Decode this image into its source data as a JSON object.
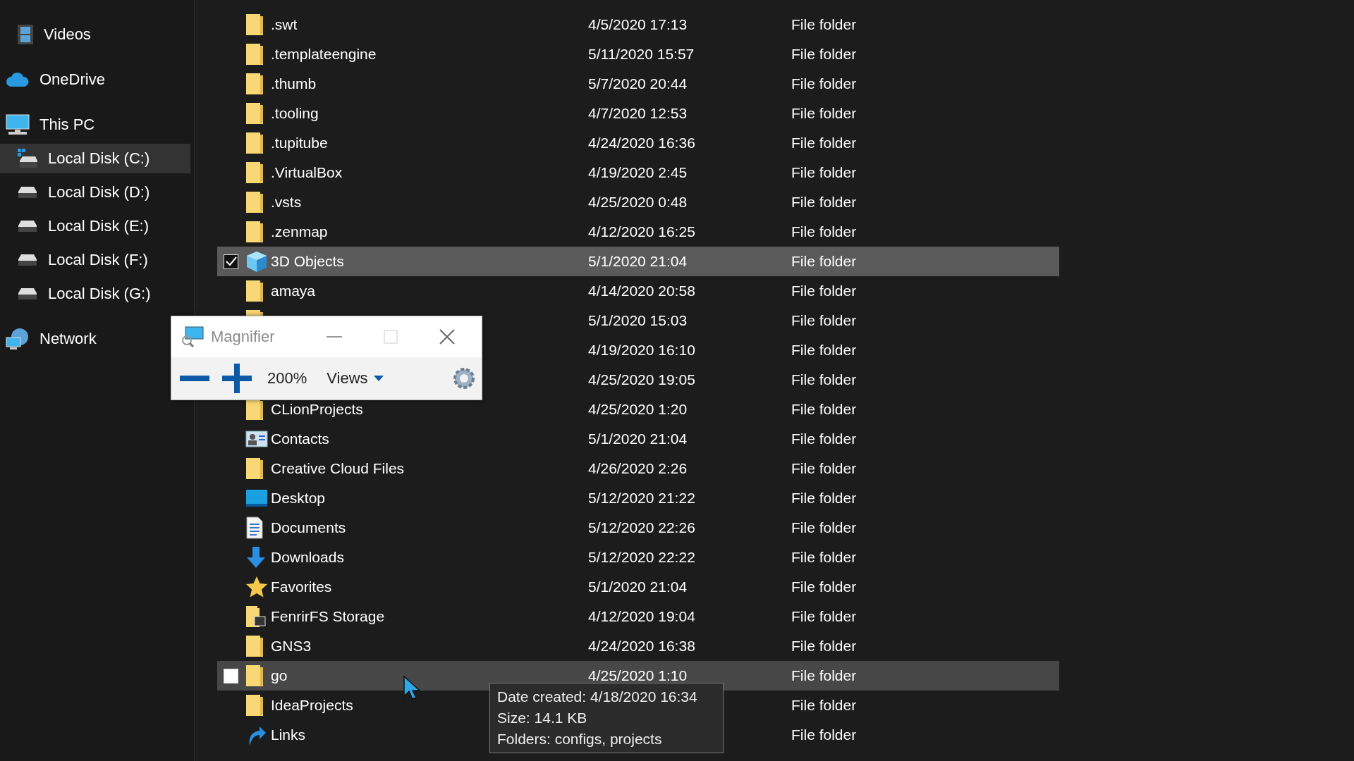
{
  "sidebar": {
    "items": [
      {
        "label": "Videos",
        "kind": "videos",
        "selected": false
      },
      {
        "label": "OneDrive",
        "kind": "cloud",
        "selected": false
      },
      {
        "label": "This PC",
        "kind": "pc",
        "selected": false
      },
      {
        "label": "Local Disk (C:)",
        "kind": "system-disk",
        "selected": true
      },
      {
        "label": "Local Disk (D:)",
        "kind": "disk",
        "selected": false
      },
      {
        "label": "Local Disk (E:)",
        "kind": "disk",
        "selected": false
      },
      {
        "label": "Local Disk (F:)",
        "kind": "disk",
        "selected": false
      },
      {
        "label": "Local Disk (G:)",
        "kind": "disk",
        "selected": false
      },
      {
        "label": "Network",
        "kind": "network",
        "selected": false
      }
    ]
  },
  "files": {
    "rows": [
      {
        "name": ".swt",
        "date": "4/5/2020 17:13",
        "type": "File folder",
        "kind": "folder",
        "selected": false,
        "hover": false
      },
      {
        "name": ".templateengine",
        "date": "5/11/2020 15:57",
        "type": "File folder",
        "kind": "folder",
        "selected": false,
        "hover": false
      },
      {
        "name": ".thumb",
        "date": "5/7/2020 20:44",
        "type": "File folder",
        "kind": "folder",
        "selected": false,
        "hover": false
      },
      {
        "name": ".tooling",
        "date": "4/7/2020 12:53",
        "type": "File folder",
        "kind": "folder",
        "selected": false,
        "hover": false
      },
      {
        "name": ".tupitube",
        "date": "4/24/2020 16:36",
        "type": "File folder",
        "kind": "folder",
        "selected": false,
        "hover": false
      },
      {
        "name": ".VirtualBox",
        "date": "4/19/2020 2:45",
        "type": "File folder",
        "kind": "folder",
        "selected": false,
        "hover": false
      },
      {
        "name": ".vsts",
        "date": "4/25/2020 0:48",
        "type": "File folder",
        "kind": "folder",
        "selected": false,
        "hover": false
      },
      {
        "name": ".zenmap",
        "date": "4/12/2020 16:25",
        "type": "File folder",
        "kind": "folder",
        "selected": false,
        "hover": false
      },
      {
        "name": "3D Objects",
        "date": "5/1/2020 21:04",
        "type": "File folder",
        "kind": "cube",
        "selected": true,
        "hover": false
      },
      {
        "name": "amaya",
        "date": "4/14/2020 20:58",
        "type": "File folder",
        "kind": "folder",
        "selected": false,
        "hover": false
      },
      {
        "date": "5/1/2020 15:03",
        "type": "File folder",
        "kind": "folder",
        "selected": false,
        "hover": false
      },
      {
        "date": "4/19/2020 16:10",
        "type": "File folder",
        "selected": false,
        "hover": false
      },
      {
        "date": "4/25/2020 19:05",
        "type": "File folder",
        "selected": false,
        "hover": false
      },
      {
        "name": "CLionProjects",
        "date": "4/25/2020 1:20",
        "type": "File folder",
        "kind": "folder",
        "selected": false,
        "hover": false
      },
      {
        "name": "Contacts",
        "date": "5/1/2020 21:04",
        "type": "File folder",
        "kind": "contacts",
        "selected": false,
        "hover": false
      },
      {
        "name": "Creative Cloud Files",
        "date": "4/26/2020 2:26",
        "type": "File folder",
        "kind": "folder",
        "selected": false,
        "hover": false
      },
      {
        "name": "Desktop",
        "date": "5/12/2020 21:22",
        "type": "File folder",
        "kind": "desktop",
        "selected": false,
        "hover": false
      },
      {
        "name": "Documents",
        "date": "5/12/2020 22:26",
        "type": "File folder",
        "kind": "documents",
        "selected": false,
        "hover": false
      },
      {
        "name": "Downloads",
        "date": "5/12/2020 22:22",
        "type": "File folder",
        "kind": "downloads",
        "selected": false,
        "hover": false
      },
      {
        "name": "Favorites",
        "date": "5/1/2020 21:04",
        "type": "File folder",
        "kind": "star",
        "selected": false,
        "hover": false
      },
      {
        "name": "FenrirFS Storage",
        "date": "4/12/2020 19:04",
        "type": "File folder",
        "kind": "storage",
        "selected": false,
        "hover": false
      },
      {
        "name": "GNS3",
        "date": "4/24/2020 16:38",
        "type": "File folder",
        "kind": "folder",
        "selected": false,
        "hover": false
      },
      {
        "name": "go",
        "date": "4/25/2020 1:10",
        "type": "File folder",
        "kind": "folder",
        "selected": false,
        "hover": true
      },
      {
        "name": "IdeaProjects",
        "type": "File folder",
        "kind": "folder",
        "selected": false,
        "hover": false
      },
      {
        "name": "Links",
        "type": "File folder",
        "kind": "links",
        "selected": false,
        "hover": false
      }
    ]
  },
  "tooltip": {
    "lines": [
      "Date created: 4/18/2020 16:34",
      "Size: 14.1 KB",
      "Folders: configs, projects"
    ]
  },
  "magnifier": {
    "title": "Magnifier",
    "zoom": "200%",
    "views": "Views"
  }
}
